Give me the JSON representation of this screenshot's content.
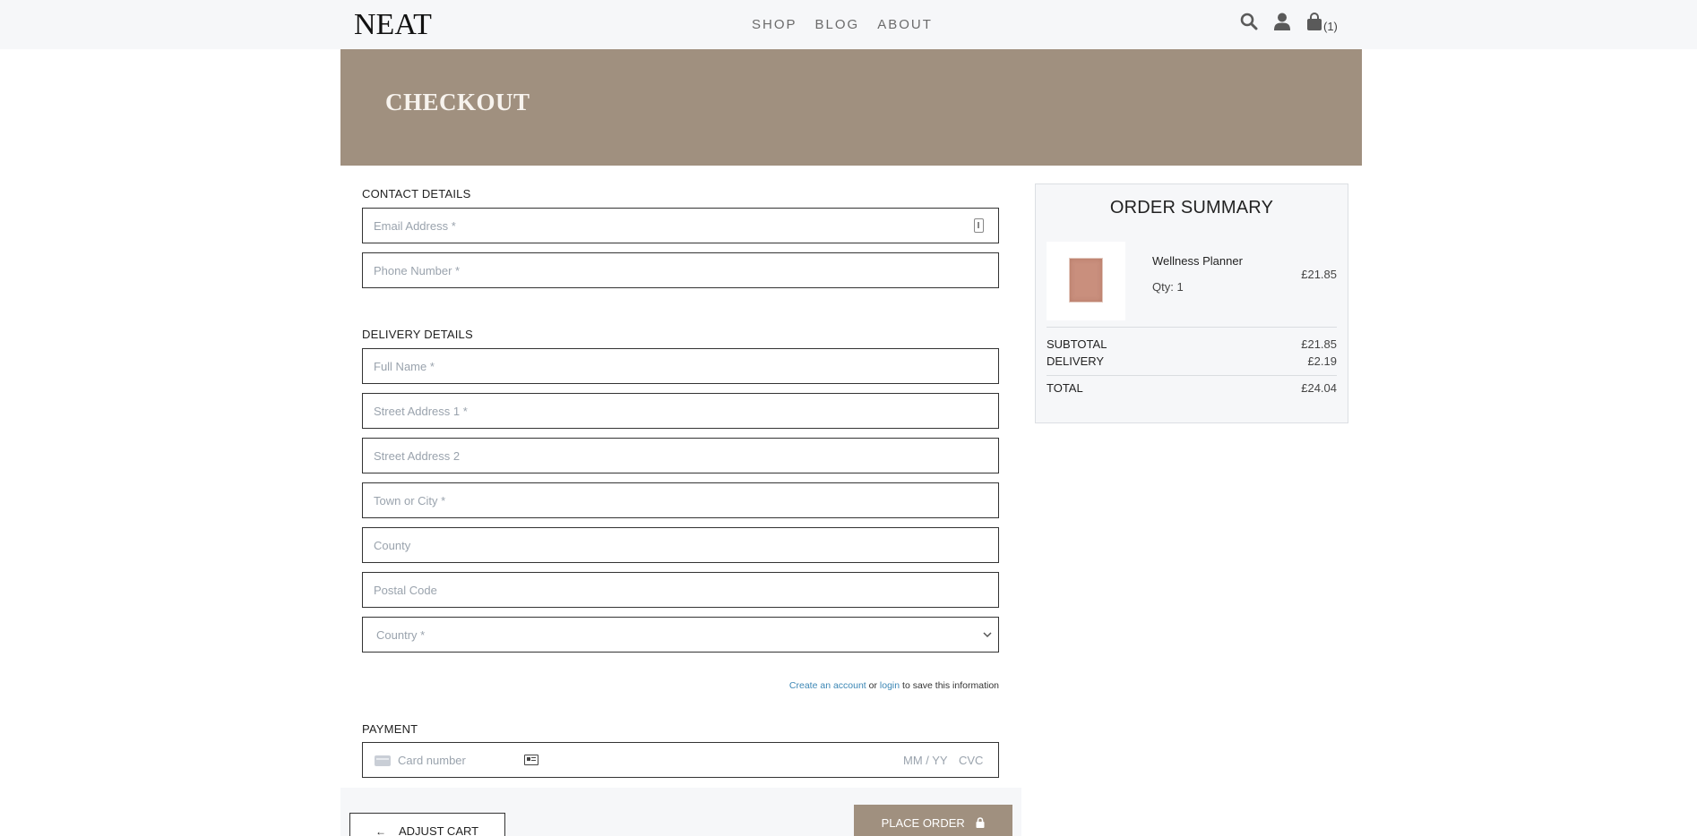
{
  "brand": {
    "logo": "NEAT"
  },
  "nav": {
    "items": [
      "SHOP",
      "BLOG",
      "ABOUT"
    ]
  },
  "header_icons": {
    "search": "search-icon",
    "account": "user-icon",
    "cart": "shopping-bag-icon",
    "cart_count": "(1)"
  },
  "hero": {
    "title": "CHECKOUT"
  },
  "contact": {
    "title": "CONTACT DETAILS",
    "email_placeholder": "Email Address *",
    "phone_placeholder": "Phone Number *"
  },
  "delivery": {
    "title": "DELIVERY DETAILS",
    "full_name_placeholder": "Full Name *",
    "street1_placeholder": "Street Address 1 *",
    "street2_placeholder": "Street Address 2",
    "town_placeholder": "Town or City *",
    "county_placeholder": "County",
    "postcode_placeholder": "Postal Code",
    "country_selected": "Country *"
  },
  "save_info": {
    "create_account": "Create an account",
    "or": "or",
    "login": "login",
    "suffix": "to save this information"
  },
  "payment": {
    "title": "PAYMENT",
    "card_number_placeholder": "Card number",
    "expiry_placeholder": "MM / YY",
    "cvc_placeholder": "CVC"
  },
  "actions": {
    "adjust_cart": "ADJUST CART",
    "place_order": "PLACE ORDER"
  },
  "summary": {
    "title": "ORDER SUMMARY",
    "product": {
      "name": "Wellness Planner",
      "qty": "Qty: 1",
      "price": "£21.85"
    },
    "subtotal_label": "SUBTOTAL",
    "subtotal_value": "£21.85",
    "delivery_label": "DELIVERY",
    "delivery_value": "£2.19",
    "total_label": "TOTAL",
    "total_value": "£24.04"
  },
  "colors": {
    "accent": "#a0907f",
    "link": "#3c87b5",
    "topbar": "#f6f7f9"
  }
}
